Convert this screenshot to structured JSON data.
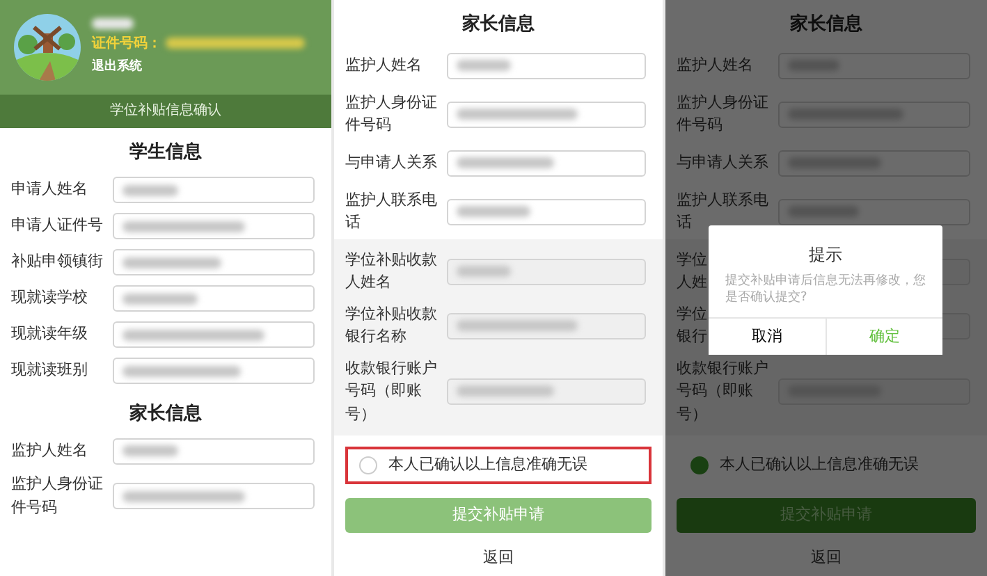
{
  "panels": [
    {
      "kind": "home",
      "header": {
        "name_redacted": true,
        "id_label": "证件号码：",
        "id_redacted": true,
        "logout": "退出系统",
        "subtitle": "学位补贴信息确认"
      },
      "sections": [
        {
          "title": "学生信息",
          "fields": [
            {
              "label": "申请人姓名",
              "redacted": true
            },
            {
              "label": "申请人证件号",
              "redacted": true
            },
            {
              "label": "补贴申领镇街",
              "redacted": true
            },
            {
              "label": "现就读学校",
              "redacted": true
            },
            {
              "label": "现就读年级",
              "redacted": true
            },
            {
              "label": "现就读班别",
              "redacted": true
            }
          ]
        },
        {
          "title": "家长信息",
          "fields": [
            {
              "label": "监护人姓名",
              "redacted": true
            },
            {
              "label": "监护人身份证件号码",
              "redacted": true
            }
          ]
        }
      ]
    },
    {
      "kind": "confirm",
      "sections": [
        {
          "title": "家长信息",
          "fields": [
            {
              "label": "监护人姓名",
              "redacted": true
            },
            {
              "label": "监护人身份证件号码",
              "redacted": true
            },
            {
              "label": "与申请人关系",
              "redacted": true
            },
            {
              "label": "监护人联系电话",
              "redacted": true
            }
          ]
        },
        {
          "shaded": true,
          "fields": [
            {
              "label": "学位补贴收款人姓名",
              "redacted": true
            },
            {
              "label": "学位补贴收款银行名称",
              "redacted": true
            },
            {
              "label": "收款银行账户号码（即账号）",
              "redacted": true
            }
          ]
        }
      ],
      "agree": {
        "label": "本人已确认以上信息准确无误",
        "checked": false,
        "highlighted": true
      },
      "submit": {
        "label": "提交补贴申请",
        "disabled": true
      },
      "back": "返回"
    },
    {
      "kind": "confirm",
      "sections": [
        {
          "title": "家长信息",
          "fields": [
            {
              "label": "监护人姓名",
              "redacted": true
            },
            {
              "label": "监护人身份证件号码",
              "redacted": true
            },
            {
              "label": "与申请人关系",
              "redacted": true
            },
            {
              "label": "监护人联系电话",
              "redacted": true
            }
          ]
        },
        {
          "shaded": true,
          "fields": [
            {
              "lines": [
                "学位",
                "人姓"
              ]
            },
            {
              "lines": [
                "学位",
                "银行"
              ]
            },
            {
              "label": "收款银行账户号码（即账号）",
              "redacted": true
            }
          ]
        }
      ],
      "agree": {
        "label": "本人已确认以上信息准确无误",
        "checked": true
      },
      "submit": {
        "label": "提交补贴申请",
        "disabled": false
      },
      "back": "返回",
      "dialog": {
        "title": "提示",
        "message": "提交补贴申请后信息无法再修改，您是否确认提交?",
        "cancel": "取消",
        "ok": "确定"
      }
    }
  ]
}
